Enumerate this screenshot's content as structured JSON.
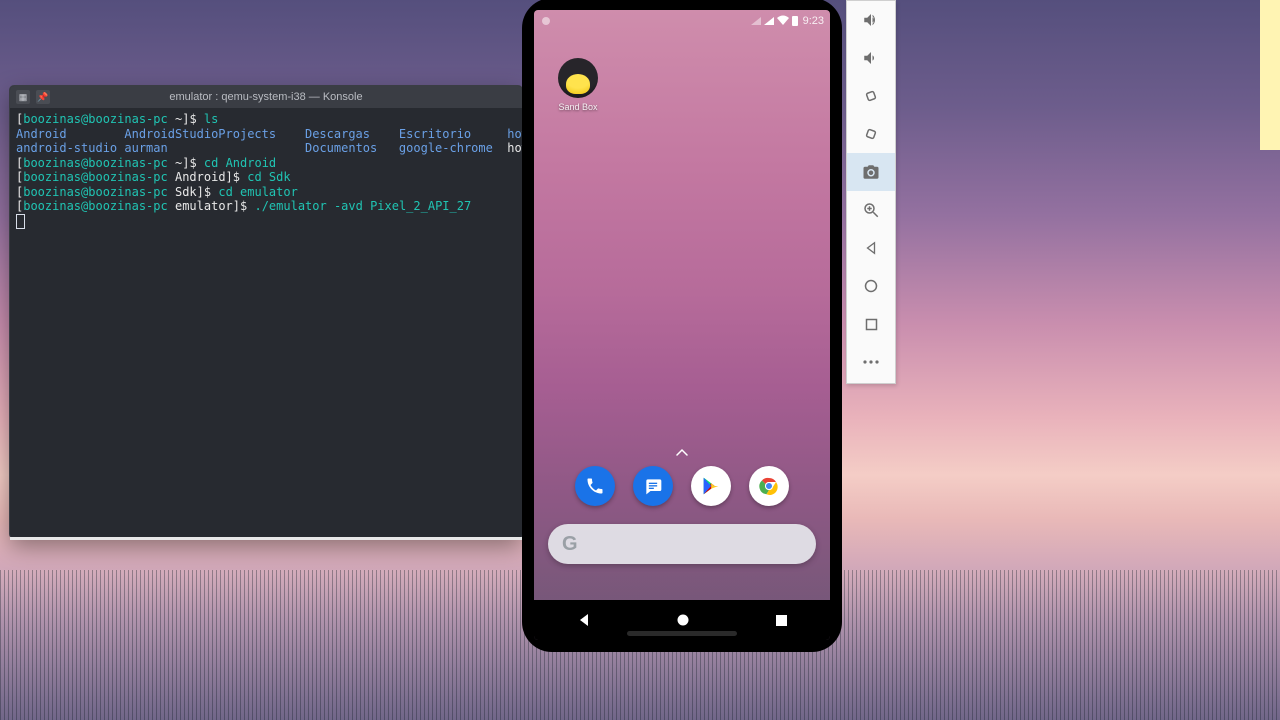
{
  "terminal": {
    "title": "emulator : qemu-system-i38 — Konsole",
    "user": "boozinas",
    "host": "boozinas-pc",
    "prompts": [
      {
        "cwd": "~",
        "cmd": "ls"
      },
      {
        "cwd": "~",
        "cmd": "cd Android"
      },
      {
        "cwd": "Android",
        "cmd": "cd Sdk"
      },
      {
        "cwd": "Sdk",
        "cmd": "cd emulator"
      },
      {
        "cwd": "emulator",
        "cmd": "./emulator -avd Pixel_2_API_27"
      }
    ],
    "ls_row1": [
      "Android",
      "AndroidStudioProjects",
      "Descargas",
      "Escritorio",
      "howdy"
    ],
    "ls_row2_dirs": [
      "android-studio",
      "aurman",
      "Documentos",
      "google-chrome"
    ],
    "ls_row2_file": "howdy.tar.gz"
  },
  "phone": {
    "status_time": "9:23",
    "home_app_label": "Sand Box",
    "dock": [
      "Phone",
      "Messages",
      "Play Store",
      "Chrome"
    ],
    "search_placeholder": ""
  },
  "emu_toolbar": {
    "buttons": [
      "volume-up",
      "volume-down",
      "rotate-left",
      "rotate-right",
      "screenshot",
      "zoom",
      "back",
      "home",
      "overview",
      "more"
    ]
  }
}
